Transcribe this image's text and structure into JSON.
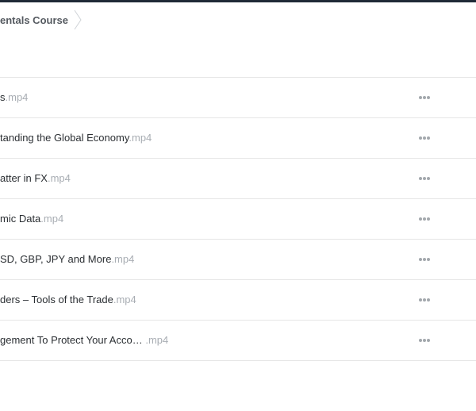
{
  "breadcrumb": {
    "course_title": "entals Course"
  },
  "files": [
    {
      "name": "s",
      "extension": ".mp4"
    },
    {
      "name": "tanding the Global Economy",
      "extension": ".mp4"
    },
    {
      "name": "atter in FX",
      "extension": ".mp4"
    },
    {
      "name": "mic Data",
      "extension": ".mp4"
    },
    {
      "name": "SD, GBP, JPY and More",
      "extension": ".mp4"
    },
    {
      "name": "ders – Tools of the Trade",
      "extension": ".mp4"
    },
    {
      "name": "gement To Protect Your Acco… ",
      "extension": ".mp4"
    }
  ],
  "icons": {
    "more": "more-options-icon",
    "separator": "chevron-right-icon"
  },
  "colors": {
    "topbar": "#1f2a37",
    "filename": "#2b2f33",
    "extension": "#a8adb3",
    "divider": "#e6e6e6"
  }
}
